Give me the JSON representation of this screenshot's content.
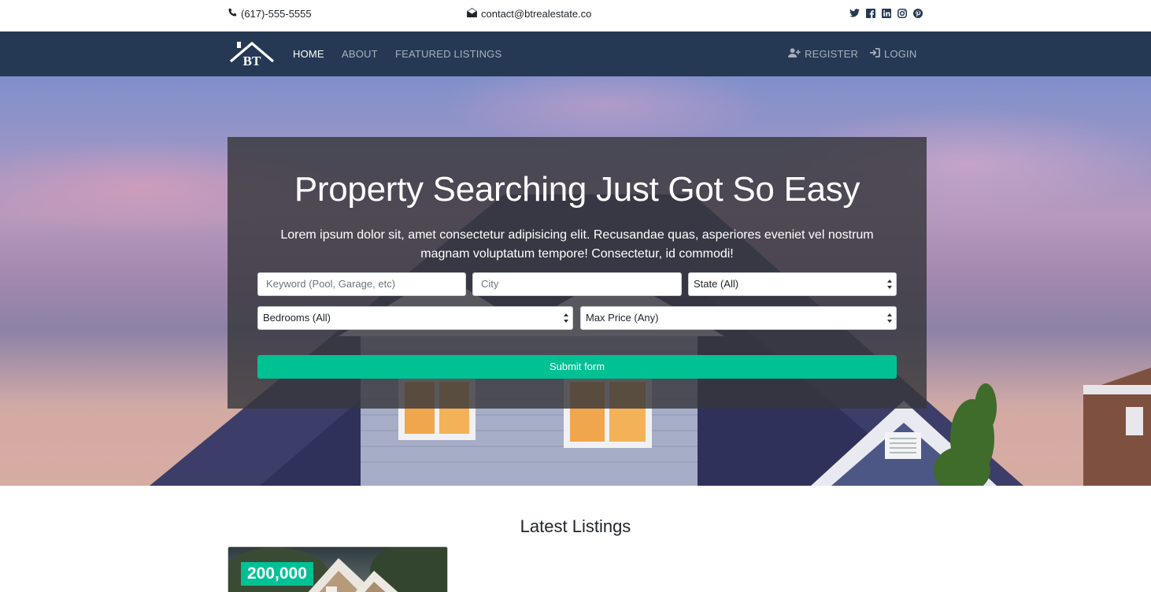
{
  "topbar": {
    "phone": "(617)-555-5555",
    "email": "contact@btrealestate.co",
    "socials": [
      "twitter-icon",
      "facebook-icon",
      "linkedin-icon",
      "instagram-icon",
      "pinterest-icon"
    ]
  },
  "nav": {
    "brand": "BT",
    "items": [
      {
        "label": "HOME",
        "active": true
      },
      {
        "label": "ABOUT",
        "active": false
      },
      {
        "label": "FEATURED LISTINGS",
        "active": false
      }
    ],
    "register": "REGISTER",
    "login": "LOGIN"
  },
  "hero": {
    "title": "Property Searching Just Got So Easy",
    "text": "Lorem ipsum dolor sit, amet consectetur adipisicing elit. Recusandae quas, asperiores eveniet vel nostrum magnam voluptatum tempore! Consectetur, id commodi!",
    "keyword_placeholder": "Keyword (Pool, Garage, etc)",
    "city_placeholder": "City",
    "state_value": "State (All)",
    "bedrooms_value": "Bedrooms (All)",
    "max_price_value": "Max Price (Any)",
    "submit": "Submit form"
  },
  "latest": {
    "title": "Latest Listings",
    "listings": [
      {
        "price": "200,000"
      }
    ]
  },
  "colors": {
    "navbar": "#253955",
    "accent": "#00c194"
  }
}
